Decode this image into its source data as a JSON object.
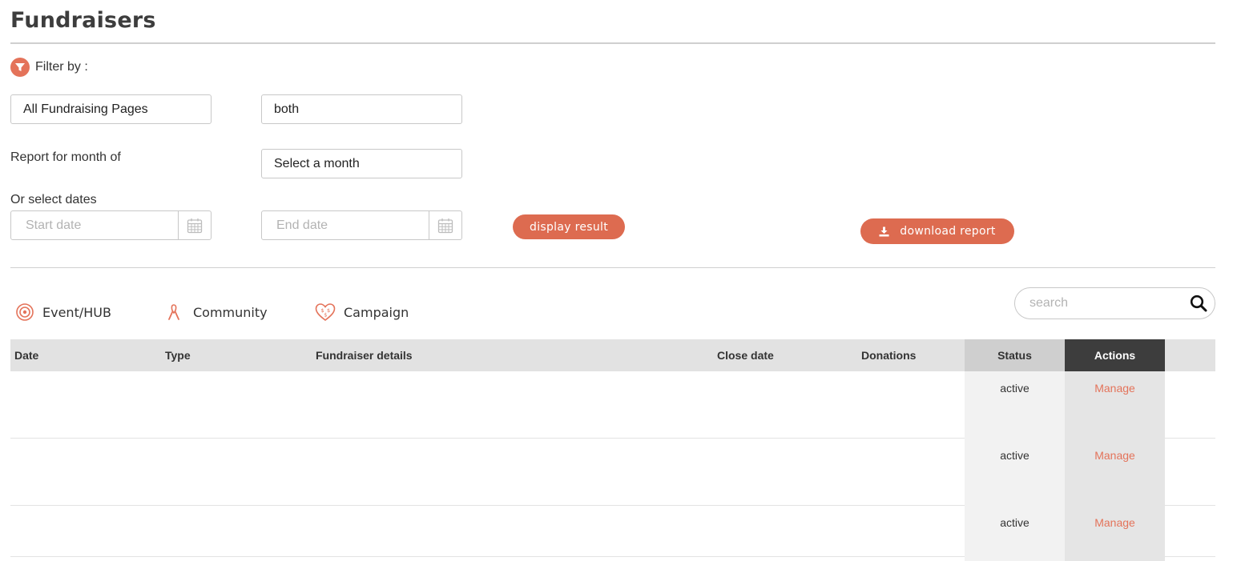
{
  "page": {
    "title": "Fundraisers"
  },
  "filter": {
    "label": "Filter by :",
    "page_type_select": "All Fundraising Pages",
    "status_select": "both",
    "month_label": "Report for month of",
    "month_select": "Select a month",
    "dates_label": "Or select dates",
    "start_placeholder": "Start date",
    "end_placeholder": "End date",
    "display_button": "display result",
    "download_button": "download report"
  },
  "types": {
    "event": "Event/HUB",
    "community": "Community",
    "campaign": "Campaign"
  },
  "search": {
    "placeholder": "search"
  },
  "table": {
    "headers": {
      "date": "Date",
      "type": "Type",
      "details": "Fundraiser details",
      "close_date": "Close date",
      "donations": "Donations",
      "status": "Status",
      "actions": "Actions"
    },
    "rows": [
      {
        "status": "active",
        "action": "Manage"
      },
      {
        "status": "active",
        "action": "Manage"
      },
      {
        "status": "active",
        "action": "Manage"
      }
    ]
  },
  "colors": {
    "accent": "#dd6b50",
    "header_dark": "#3d3d3d"
  },
  "icons": {
    "filter": "filter-icon",
    "calendar": "calendar-icon",
    "download": "download-icon",
    "event": "target-icon",
    "community": "ribbon-icon",
    "campaign": "heart-money-icon",
    "search": "search-icon"
  }
}
